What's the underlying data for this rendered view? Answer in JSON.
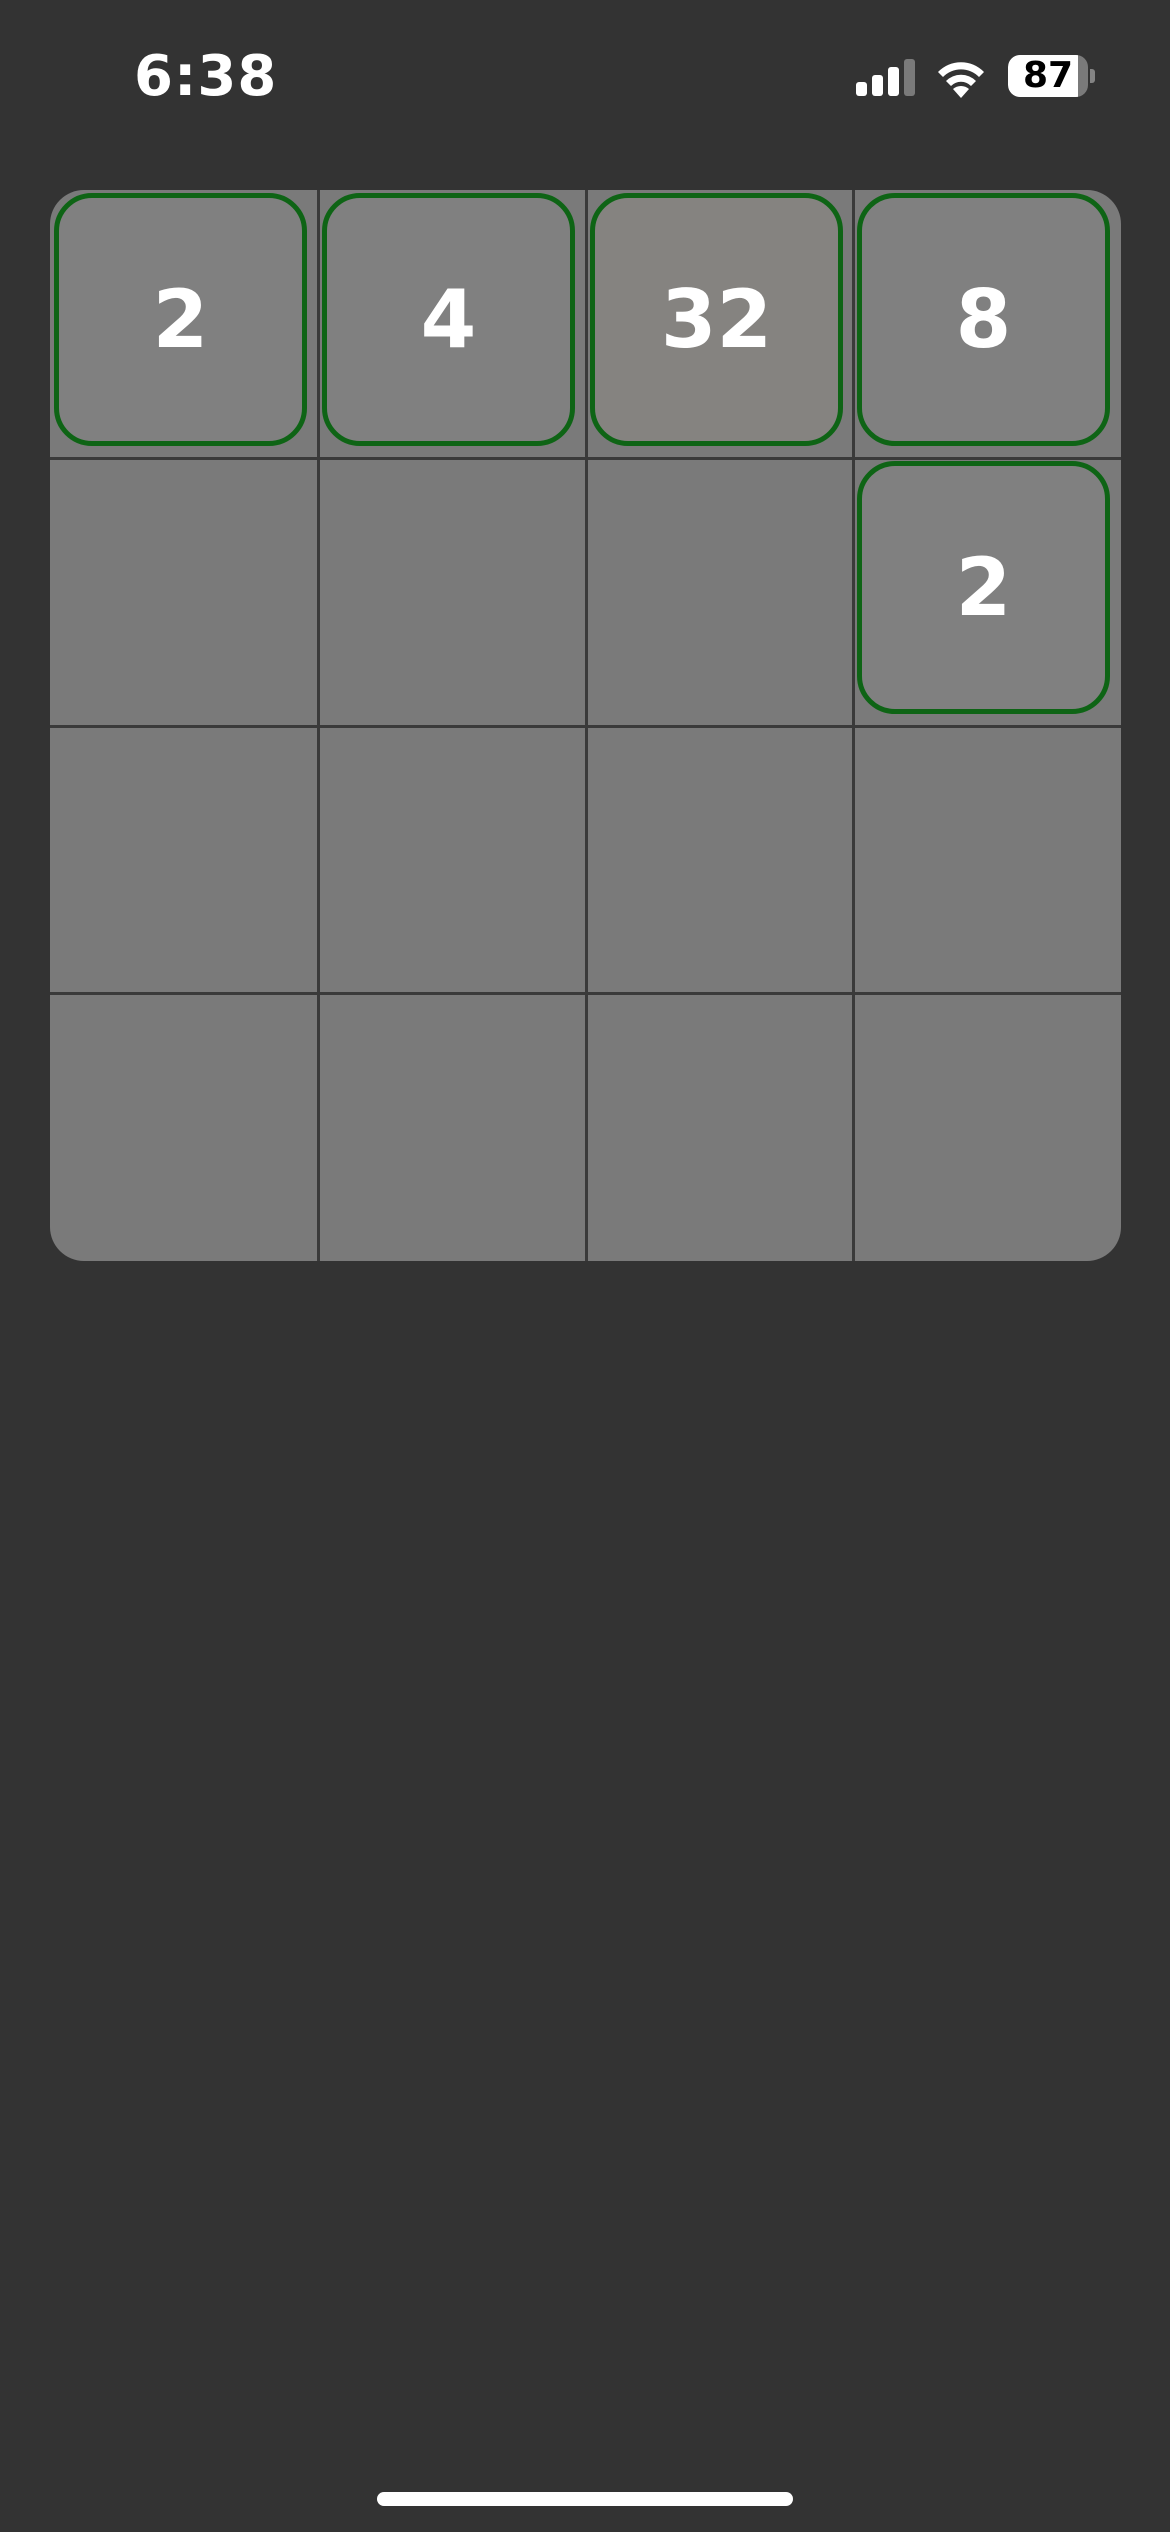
{
  "status_bar": {
    "time": "6:38",
    "battery_percent": "87",
    "battery_level": 0.87,
    "signal_bars_active": 3
  },
  "board": {
    "size": 4,
    "tiles": [
      {
        "row": 0,
        "col": 0,
        "value": "2",
        "color": "#808080"
      },
      {
        "row": 0,
        "col": 1,
        "value": "4",
        "color": "#808080"
      },
      {
        "row": 0,
        "col": 2,
        "value": "32",
        "color": "#858380"
      },
      {
        "row": 0,
        "col": 3,
        "value": "8",
        "color": "#808080"
      },
      {
        "row": 1,
        "col": 3,
        "value": "2",
        "color": "#808080"
      }
    ]
  },
  "colors": {
    "background": "#333333",
    "board": "#7a7a7a",
    "grid_line": "#3a3a3a",
    "tile_border": "#0e6415",
    "tile_text": "#ffffff"
  },
  "icons": [
    "cellular-signal-icon",
    "wifi-icon",
    "battery-icon"
  ]
}
